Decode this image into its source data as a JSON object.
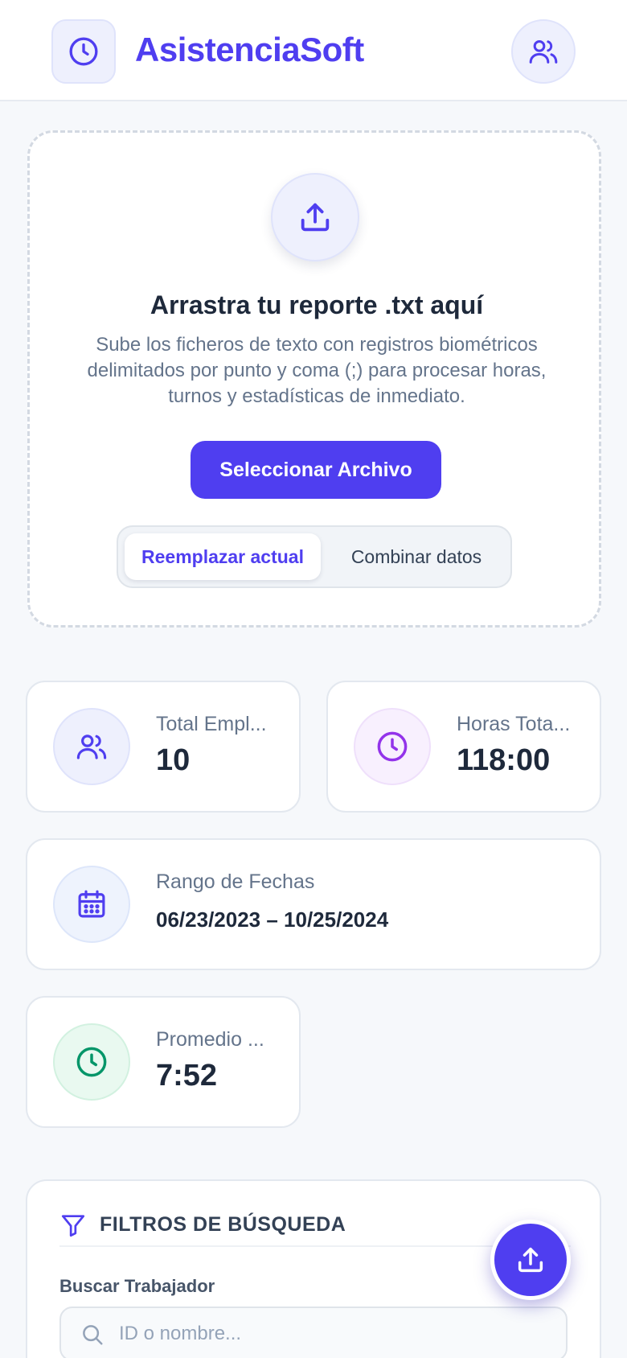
{
  "header": {
    "brand": "AsistenciaSoft",
    "logo_icon": "clock-icon",
    "users_icon": "users-icon",
    "accent": "#4f3ef0"
  },
  "upload": {
    "icon": "upload-icon",
    "title": "Arrastra tu reporte .txt aquí",
    "description": "Sube los ficheros de texto con registros biométricos delimitados por punto y coma (;) para procesar horas, turnos y estadísticas de inmediato.",
    "select_button": "Seleccionar Archivo",
    "mode_options": [
      "Reemplazar actual",
      "Combinar datos"
    ],
    "mode_selected": "Reemplazar actual"
  },
  "stats": {
    "employees": {
      "label": "Total Empl...",
      "value": "10",
      "icon": "users-icon",
      "color": "#4f3ef0"
    },
    "hours": {
      "label": "Horas Tota...",
      "value": "118:00",
      "icon": "clock-icon",
      "color": "#9333ea"
    },
    "range": {
      "label": "Rango de Fechas",
      "value": "06/23/2023 – 10/25/2024",
      "icon": "calendar-icon",
      "color": "#4f3ef0"
    },
    "average": {
      "label": "Promedio ...",
      "value": "7:52",
      "icon": "clock-icon",
      "color": "#059669"
    }
  },
  "filters": {
    "title": "FILTROS DE BÚSQUEDA",
    "icon": "filter-icon",
    "search_label": "Buscar Trabajador",
    "search_placeholder": "ID o nombre...",
    "search_value": ""
  },
  "fab": {
    "icon": "upload-icon"
  }
}
